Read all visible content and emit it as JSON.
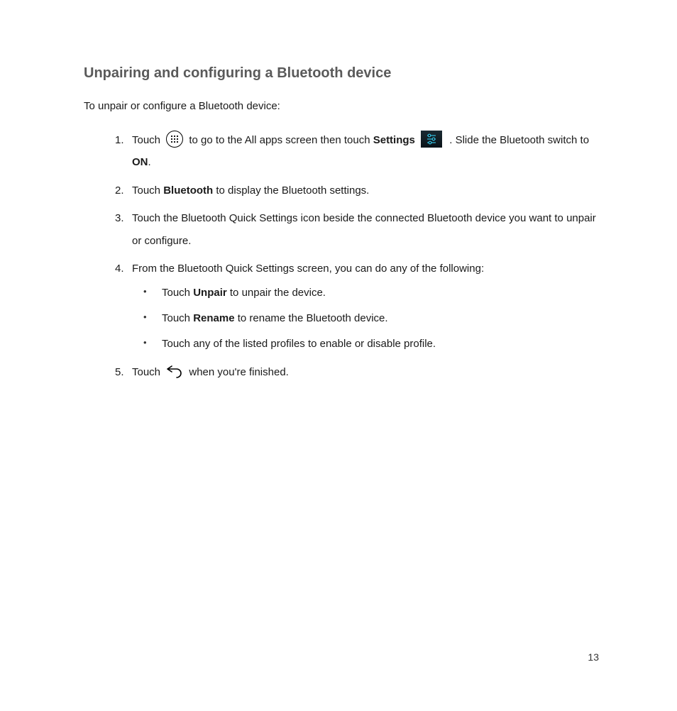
{
  "heading": "Unpairing and configuring a Bluetooth device",
  "intro": "To unpair or configure a Bluetooth device:",
  "steps": {
    "s1": {
      "pre": "Touch ",
      "mid1": " to go to the All apps screen then touch ",
      "settings": "Settings",
      "mid2": " . Slide the Bluetooth switch to ",
      "on": "ON",
      "post": "."
    },
    "s2": {
      "pre": "Touch ",
      "bluetooth": "Bluetooth",
      "post": " to display the Bluetooth settings."
    },
    "s3": "Touch the Bluetooth Quick Settings icon beside the connected Bluetooth device you want to unpair or configure.",
    "s4": {
      "lead": "From the Bluetooth Quick Settings screen, you can do any of the following:",
      "b1": {
        "pre": "Touch ",
        "bold": "Unpair",
        "post": " to unpair the device."
      },
      "b2": {
        "pre": "Touch ",
        "bold": "Rename",
        "post": " to rename the Bluetooth device."
      },
      "b3": "Touch any of the listed profiles to enable or disable profile."
    },
    "s5": {
      "pre": "Touch ",
      "post": " when you're finished."
    }
  },
  "pageNumber": "13"
}
